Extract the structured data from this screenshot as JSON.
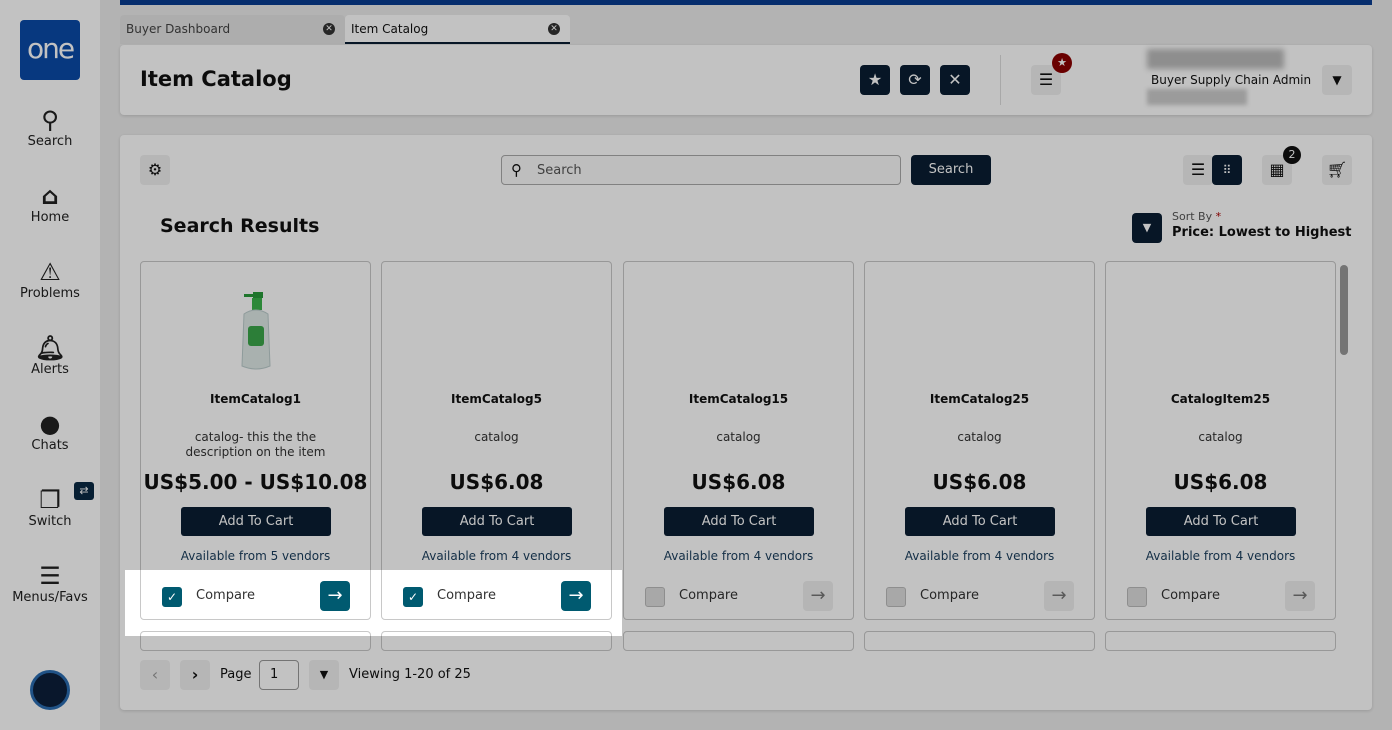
{
  "sidebar": {
    "logo": "one",
    "items": [
      {
        "label": "Search",
        "icon": "search-icon"
      },
      {
        "label": "Home",
        "icon": "home-icon"
      },
      {
        "label": "Problems",
        "icon": "warning-icon"
      },
      {
        "label": "Alerts",
        "icon": "bell-icon"
      },
      {
        "label": "Chats",
        "icon": "chat-icon"
      },
      {
        "label": "Switch",
        "icon": "switch-icon"
      },
      {
        "label": "Menus/Favs",
        "icon": "menu-icon"
      }
    ],
    "switch_badge": "⇄"
  },
  "tabs": [
    {
      "label": "Buyer Dashboard"
    },
    {
      "label": "Item Catalog",
      "active": true
    }
  ],
  "header": {
    "title": "Item Catalog",
    "user_role": "Buyer Supply Chain Admin"
  },
  "toolbar": {
    "search_placeholder": "Search",
    "search_button": "Search",
    "compare_count": "2"
  },
  "results": {
    "title": "Search Results",
    "sort_label": "Sort By",
    "sort_required": "*",
    "sort_value": "Price: Lowest to Highest"
  },
  "items": [
    {
      "name": "ItemCatalog1",
      "desc": "catalog- this the the description on the item",
      "price": "US$5.00 - US$10.08",
      "add": "Add To Cart",
      "vendors": "Available from 5 vendors",
      "compare": "Compare",
      "checked": true
    },
    {
      "name": "ItemCatalog5",
      "desc": "catalog",
      "price": "US$6.08",
      "add": "Add To Cart",
      "vendors": "Available from 4 vendors",
      "compare": "Compare",
      "checked": true
    },
    {
      "name": "ItemCatalog15",
      "desc": "catalog",
      "price": "US$6.08",
      "add": "Add To Cart",
      "vendors": "Available from 4 vendors",
      "compare": "Compare",
      "checked": false
    },
    {
      "name": "ItemCatalog25",
      "desc": "catalog",
      "price": "US$6.08",
      "add": "Add To Cart",
      "vendors": "Available from 4 vendors",
      "compare": "Compare",
      "checked": false
    },
    {
      "name": "CatalogItem25",
      "desc": "catalog",
      "price": "US$6.08",
      "add": "Add To Cart",
      "vendors": "Available from 4 vendors",
      "compare": "Compare",
      "checked": false
    }
  ],
  "pagination": {
    "page_label": "Page",
    "page": "1",
    "viewing": "Viewing 1-20 of 25"
  },
  "colors": {
    "brand": "#0a3d91",
    "primary": "#0a1e33",
    "compare": "#005a70"
  }
}
